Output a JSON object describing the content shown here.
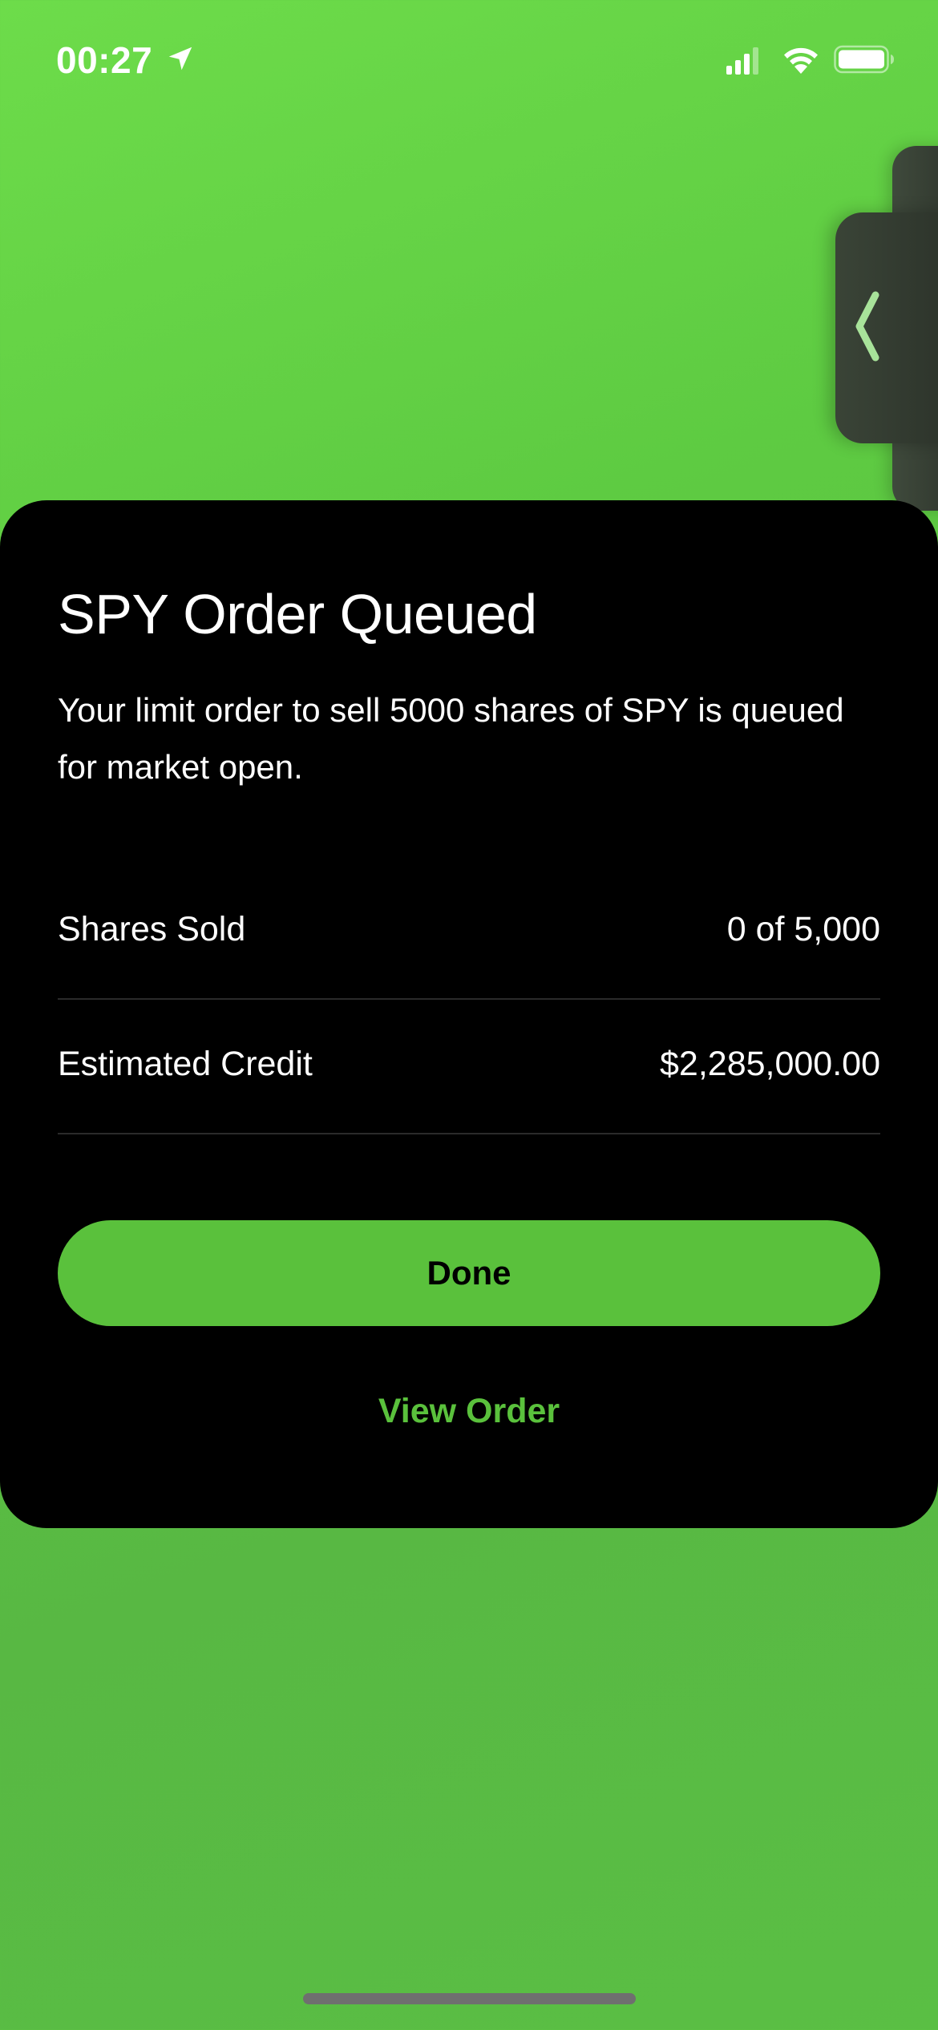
{
  "status_bar": {
    "time": "00:27",
    "icons": [
      "location-arrow-icon",
      "cellular-signal-icon",
      "wifi-icon",
      "battery-icon"
    ]
  },
  "side_handle": {
    "icon": "chevron-left-icon"
  },
  "sheet": {
    "title": "SPY Order Queued",
    "message": "Your limit order to sell 5000 shares of SPY is queued for market open.",
    "details": [
      {
        "label": "Shares Sold",
        "value": "0 of 5,000"
      },
      {
        "label": "Estimated Credit",
        "value": "$2,285,000.00"
      }
    ],
    "primary_button": "Done",
    "secondary_link": "View Order"
  },
  "colors": {
    "accent": "#5ac13c",
    "background_green": "#5ecb42",
    "sheet_background": "#000000",
    "handle": "#333b30"
  }
}
